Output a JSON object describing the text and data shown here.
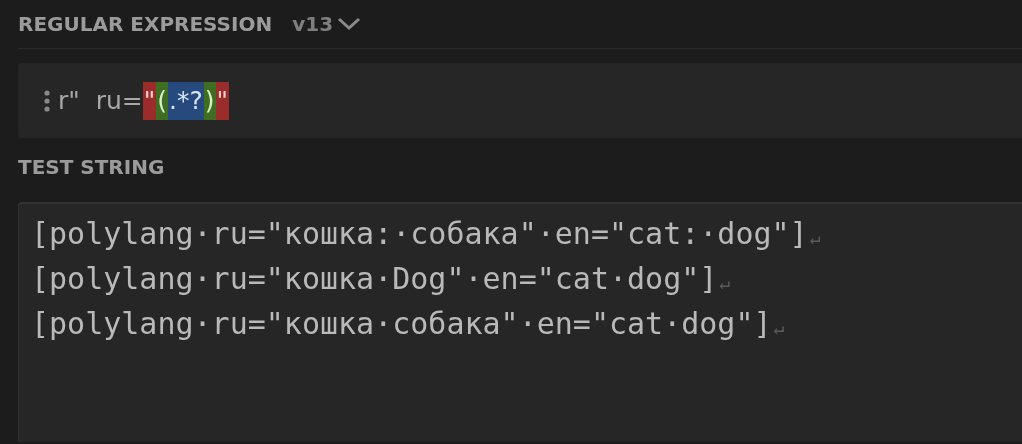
{
  "regex_section": {
    "title": "REGULAR EXPRESSION",
    "version": "v13"
  },
  "regex": {
    "tokens": [
      {
        "kind": "plain",
        "text": "r\"  ru="
      },
      {
        "kind": "quote",
        "text": "\""
      },
      {
        "kind": "group",
        "text": "("
      },
      {
        "kind": "quantifier",
        "text": ".*?"
      },
      {
        "kind": "group",
        "text": ")"
      },
      {
        "kind": "quote",
        "text": "\""
      }
    ]
  },
  "test_section": {
    "title": "TEST STRING"
  },
  "test_lines": [
    {
      "text": "[polylang·ru=\"кошка:·собака\"·en=\"cat:·dog\"]",
      "eol": "↵"
    },
    {
      "text": "[polylang·ru=\"кошка·Dog\"·en=\"cat·dog\"]",
      "eol": "↵"
    },
    {
      "text": "[polylang·ru=\"кошка·собака\"·en=\"cat·dog\"]",
      "eol": "↵"
    }
  ]
}
